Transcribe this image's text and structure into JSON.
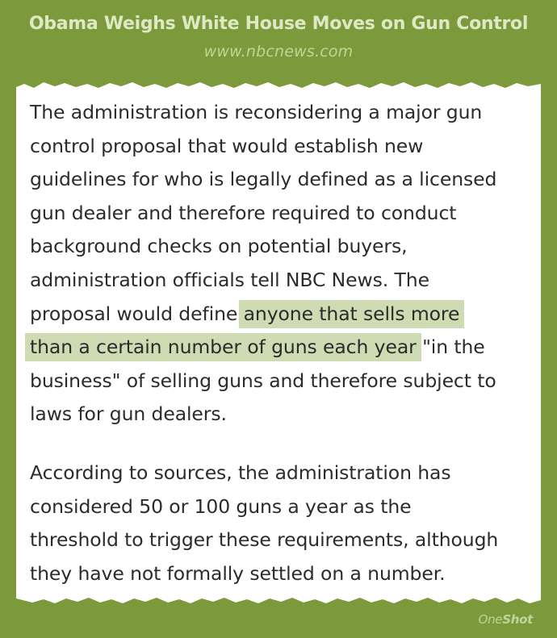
{
  "header": {
    "title": "Obama Weighs White House Moves on Gun Control",
    "source": "www.nbcnews.com"
  },
  "article": {
    "paragraph1": [
      {
        "text": "The administration is reconsidering a major gun"
      },
      {
        "text": "control proposal that would establish new"
      },
      {
        "text": "guidelines for who is legally defined as a licensed"
      },
      {
        "text": "gun dealer and therefore required to conduct"
      },
      {
        "text": "background checks on potential buyers,"
      },
      {
        "text": "administration officials tell NBC News. The"
      },
      {
        "pre": "proposal would define ",
        "highlight": "anyone that sells more"
      },
      {
        "highlight": "than a certain number of guns each year",
        "post": " \"in the"
      },
      {
        "text": "business\" of selling guns and therefore subject to"
      },
      {
        "text": "laws for gun dealers."
      }
    ],
    "paragraph2": [
      {
        "text": "According to sources, the administration has"
      },
      {
        "text": "considered 50 or 100 guns a year as the"
      },
      {
        "text": "threshold to trigger these requirements, although"
      },
      {
        "text": "they have not formally settled on a number."
      }
    ]
  },
  "branding": {
    "logo_part1": "One",
    "logo_part2": "Shot"
  },
  "colors": {
    "background": "#7c9a3c",
    "title": "#dfe8c4",
    "source": "#c3d39a",
    "card": "#ffffff",
    "text": "#2b2b2b",
    "highlight": "#cfdbb3"
  }
}
